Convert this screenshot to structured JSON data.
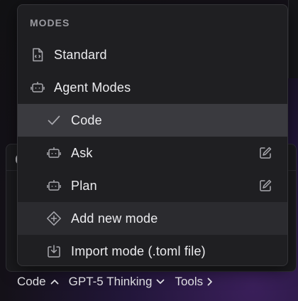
{
  "menu": {
    "section_title": "MODES",
    "items": [
      {
        "label": "Standard",
        "icon": "document-code-icon"
      },
      {
        "label": "Agent Modes",
        "icon": "robot-icon"
      },
      {
        "label": "Code",
        "icon": "check-icon",
        "selected": true
      },
      {
        "label": "Ask",
        "icon": "robot-icon",
        "editable": true
      },
      {
        "label": "Plan",
        "icon": "robot-icon",
        "editable": true
      },
      {
        "label": "Add new mode",
        "icon": "plus-circle-icon"
      },
      {
        "label": "Import mode (.toml file)",
        "icon": "import-icon"
      }
    ]
  },
  "toolbar": {
    "mode_label": "Code",
    "model_label": "GPT-5 Thinking",
    "tools_label": "Tools"
  },
  "colors": {
    "menu_bg": "#1f1f22",
    "selected_bg": "#3a3a3f",
    "hover_bg": "#2b2b2f",
    "text": "#ececef",
    "muted": "#9a9aa0"
  }
}
